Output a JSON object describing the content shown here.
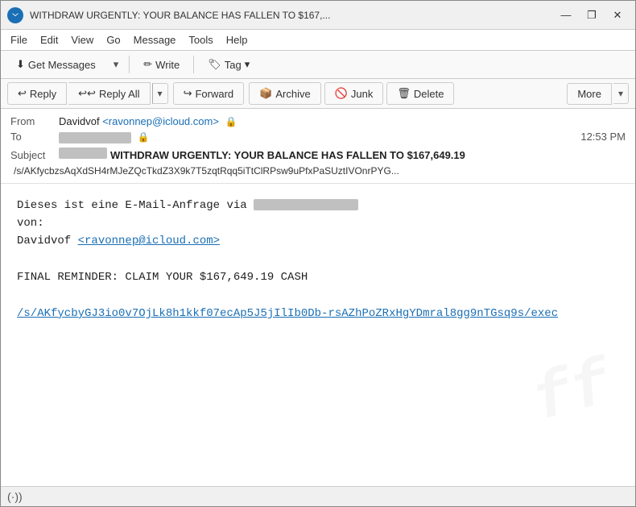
{
  "window": {
    "title": "WITHDRAW URGENTLY: YOUR BALANCE HAS FALLEN TO $167,...",
    "icon": "thunderbird-icon"
  },
  "titlebar": {
    "minimize_label": "—",
    "restore_label": "❐",
    "close_label": "✕"
  },
  "menubar": {
    "items": [
      "File",
      "Edit",
      "View",
      "Go",
      "Message",
      "Tools",
      "Help"
    ]
  },
  "toolbar1": {
    "get_messages_label": "Get Messages",
    "write_label": "Write",
    "tag_label": "Tag",
    "dropdown_arrow": "▾"
  },
  "toolbar2": {
    "reply_label": "Reply",
    "reply_all_label": "Reply All",
    "forward_label": "Forward",
    "archive_label": "Archive",
    "junk_label": "Junk",
    "delete_label": "Delete",
    "more_label": "More",
    "dropdown_arrow": "▾"
  },
  "email": {
    "from_label": "From",
    "from_name": "Davidvof",
    "from_email": "<ravonnep@icloud.com>",
    "to_label": "To",
    "time": "12:53 PM",
    "subject_label": "Subject",
    "subject_main": "WITHDRAW URGENTLY: YOUR BALANCE HAS FALLEN TO $167,649.19",
    "hash_line": "/s/AKfycbzsAqXdSH4rMJeZQcTkdZ3X9k7T5zqtRqq5iTtClRPsw9uPfxPaSUztIVOnrPYG...",
    "body_line1": "Dieses ist eine E-Mail-Anfrage via",
    "body_line2": "von:",
    "body_line3": "Davidvof ",
    "body_email_link": "<ravonnep@icloud.com>",
    "body_line4": "",
    "body_line5": "FINAL REMINDER: CLAIM YOUR $167,649.19 CASH",
    "body_url": "/s/AKfycbyGJ3io0v7OjLk8h1kkf07ecAp5J5jIlIb0Db-rsAZhPoZRxHgYDmral8gg9nTGsq9s/exec"
  },
  "statusbar": {
    "wifi_icon": "(·))"
  }
}
